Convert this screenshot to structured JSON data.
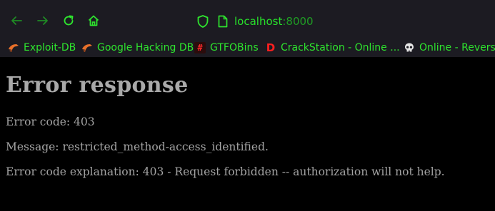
{
  "browser": {
    "url": {
      "host": "localhost",
      "port": ":8000"
    },
    "accent_color": "#28e02b",
    "toolbar_icons": [
      "back-arrow-icon",
      "forward-arrow-icon",
      "reload-icon",
      "home-icon",
      "shield-icon",
      "page-icon"
    ]
  },
  "bookmarks": [
    {
      "label": "Exploit-DB",
      "icon": "exploit-db-icon"
    },
    {
      "label": "Google Hacking DB",
      "icon": "ghdb-icon"
    },
    {
      "label": "GTFOBins",
      "icon": "gtfobins-icon",
      "glyph": "#"
    },
    {
      "label": "CrackStation - Online ...",
      "icon": "crackstation-icon",
      "glyph": "D"
    },
    {
      "label": "Online - Reverse",
      "icon": "skull-icon",
      "glyph": "💀"
    }
  ],
  "page": {
    "title": "Error response",
    "lines": [
      "Error code: 403",
      "Message: restricted_method-access_identified.",
      "Error code explanation: 403 - Request forbidden -- authorization will not help."
    ]
  }
}
